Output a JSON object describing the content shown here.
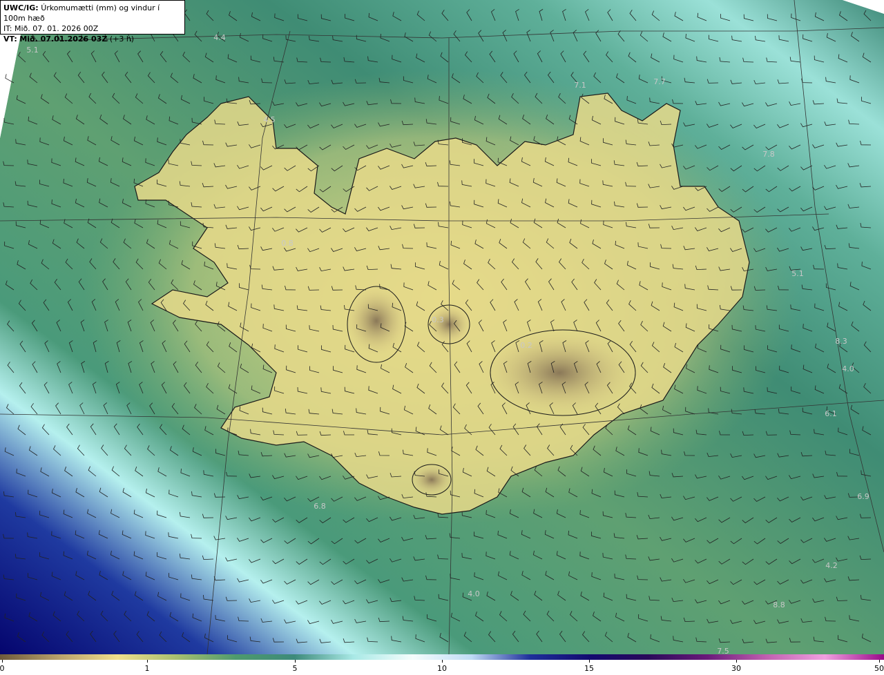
{
  "header": {
    "model": "UWC/IG:",
    "title": "Úrkomumætti (mm) og vindur í 100m hæð",
    "it_label": "IT:",
    "it_value": "Mið. 07. 01. 2026 00Z",
    "vt_label": "VT:",
    "vt_value": "Mið. 07.01.2026 03Z",
    "vt_offset": "(+3 h)"
  },
  "colorbar": {
    "ticks": [
      "0",
      "1",
      "5",
      "10",
      "15",
      "30",
      "50"
    ],
    "colors": [
      "#6e5a3c",
      "#b9a26c",
      "#f0e08c",
      "#a8c070",
      "#4e9a6e",
      "#3d8a7a",
      "#a9e9e6",
      "#f5fdfc",
      "#c0dcf5",
      "#1e2f9a",
      "#130a70",
      "#2a0a5a",
      "#6a1a7a",
      "#c060b0",
      "#f0a0e0",
      "#9a0a8a"
    ]
  },
  "map": {
    "land_colors": {
      "low": "#f2e38c",
      "high": "#8d7b5c",
      "sea_near": "#79ac6e",
      "sea": "#3f8c74",
      "sea_far": "#9be1d8",
      "deep": "#0a0a7a"
    },
    "value_labels": [
      "5.1",
      "4.4",
      "4.5",
      "7.1",
      "7.7",
      "7.8",
      "0.8",
      "0.3",
      "0.2",
      "6.8",
      "6.1",
      "4.2",
      "4.0",
      "7.5",
      "4.0",
      "5.1",
      "8.3",
      "8.8",
      "6.9"
    ]
  }
}
